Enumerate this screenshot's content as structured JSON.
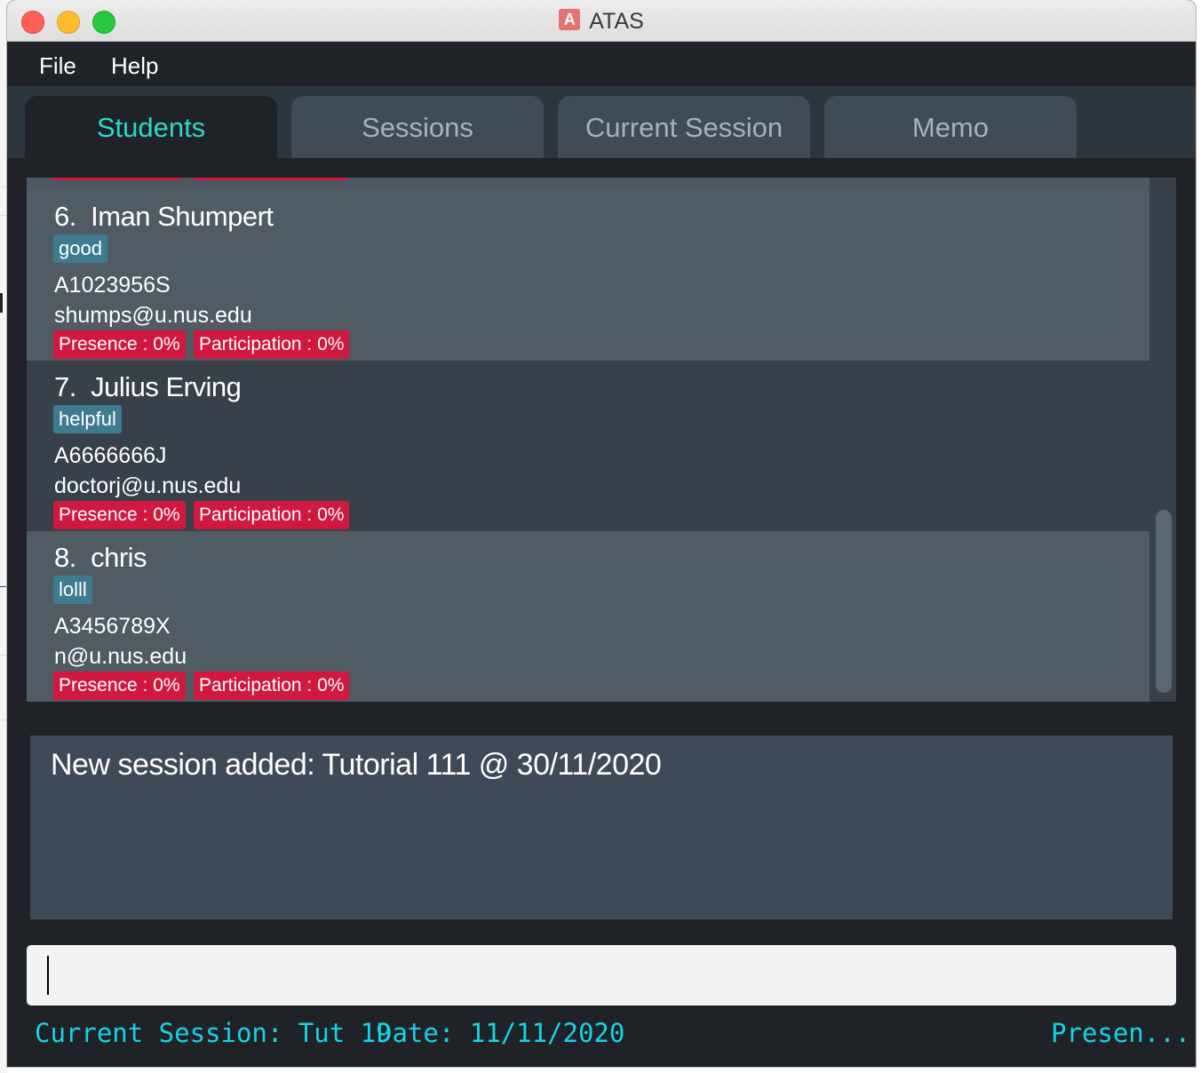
{
  "window": {
    "title": "ATAS",
    "app_icon_letter": "A"
  },
  "menu": [
    {
      "label": "File"
    },
    {
      "label": "Help"
    }
  ],
  "tabs": [
    {
      "label": "Students",
      "active": true
    },
    {
      "label": "Sessions",
      "active": false
    },
    {
      "label": "Current Session",
      "active": false
    },
    {
      "label": "Memo",
      "active": false
    }
  ],
  "students": [
    {
      "index": "6.",
      "name": "Iman Shumpert",
      "tag": "good",
      "id": "A1023956S",
      "email": "shumps@u.nus.edu",
      "presence": "Presence : 0%",
      "participation": "Participation : 0%"
    },
    {
      "index": "7.",
      "name": "Julius Erving",
      "tag": "helpful",
      "id": "A6666666J",
      "email": "doctorj@u.nus.edu",
      "presence": "Presence : 0%",
      "participation": "Participation : 0%"
    },
    {
      "index": "8.",
      "name": "chris",
      "tag": "lolll",
      "id": "A3456789X",
      "email": "n@u.nus.edu",
      "presence": "Presence : 0%",
      "participation": "Participation : 0%"
    }
  ],
  "result_message": "New session added: Tutorial 111 @ 30/11/2020",
  "command_box": {
    "value": ""
  },
  "status_bar": {
    "current_session": "Current Session: Tut 19",
    "date": "Date: 11/11/2020",
    "presence": "Presen..."
  },
  "colors": {
    "accent_tab": "#2fd6c8",
    "status_text": "#15d3e4",
    "tag_bg": "#3e7b91",
    "stat_badge_bg": "#d1183f",
    "window_bg": "#1f2327"
  }
}
